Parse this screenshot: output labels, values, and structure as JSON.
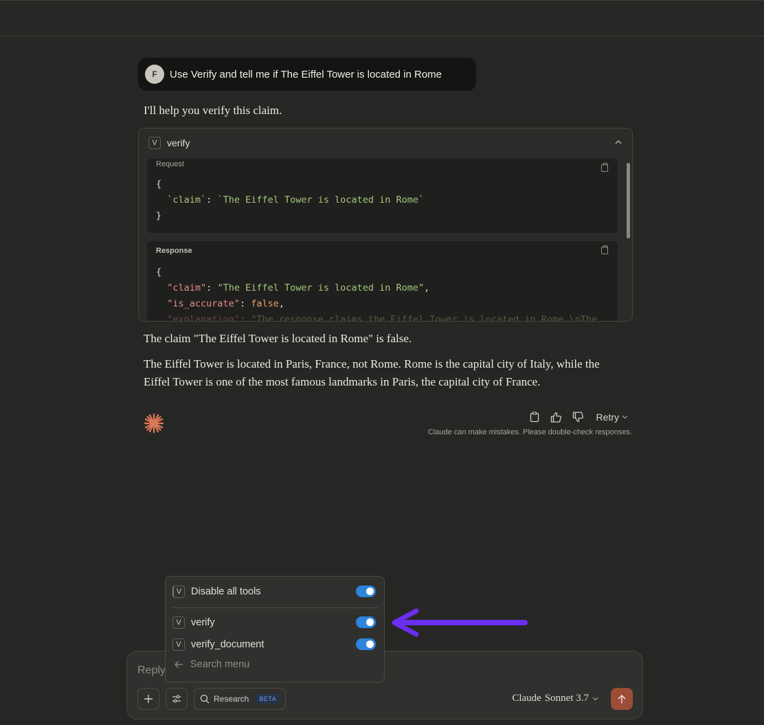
{
  "user_message": {
    "avatar_initial": "F",
    "text": "Use Verify and tell me if  The Eiffel Tower is located in Rome"
  },
  "assistant": {
    "intro": "I'll help you verify this claim.",
    "tool_call": {
      "badge": "V",
      "name": "verify",
      "request_label": "Request",
      "request_open": "{",
      "request_key": "`claim`",
      "request_colon": ": ",
      "request_value": "`The Eiffel Tower is located in Rome`",
      "request_close": "}",
      "response_label": "Response",
      "response_open": "{",
      "response_key1": "\"claim\"",
      "response_value1": "\"The Eiffel Tower is located in Rome\"",
      "response_key2": "\"is_accurate\"",
      "response_value2": "false",
      "response_key3": "\"explanation\"",
      "response_value3": "\"The response claims the Eiffel Tower is located in Rome.\\nThe"
    },
    "claim_result": "The claim \"The Eiffel Tower is located in Rome\" is false.",
    "body": "The Eiffel Tower is located in Paris, France, not Rome. Rome is the capital city of Italy, while the Eiffel Tower is one of the most famous landmarks in Paris, the capital city of France.",
    "retry_label": "Retry",
    "disclaimer": "Claude can make mistakes. Please double-check responses."
  },
  "tools_menu": {
    "items": [
      {
        "badge": "V",
        "label": "Disable all tools",
        "enabled": true
      },
      {
        "badge": "V",
        "label": "verify",
        "enabled": true
      },
      {
        "badge": "V",
        "label": "verify_document",
        "enabled": true
      }
    ],
    "search_placeholder": "Search menu"
  },
  "composer": {
    "placeholder": "Reply to Claude...",
    "research_label": "Research",
    "research_badge": "BETA",
    "model_name": "Claude",
    "model_version": "Sonnet 3.7"
  },
  "colors": {
    "background": "#262624",
    "toggle_on": "#2c84db",
    "send_button": "#9b4d36",
    "annotation_arrow": "#6b2ff0",
    "claude_logo": "#d97757"
  }
}
